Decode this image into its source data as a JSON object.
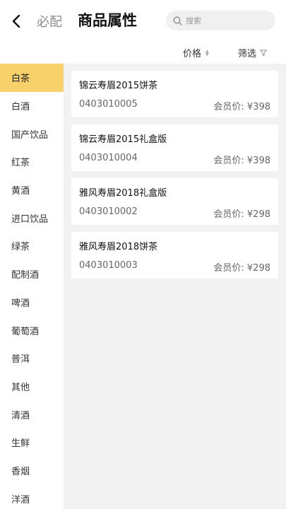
{
  "header": {
    "tab_inactive": "必配",
    "tab_active": "商品属性",
    "search_placeholder": "搜索"
  },
  "sortbar": {
    "price_label": "价格",
    "filter_label": "筛选"
  },
  "categories": [
    {
      "label": "白茶",
      "active": true
    },
    {
      "label": "白酒",
      "active": false
    },
    {
      "label": "国产饮品",
      "active": false
    },
    {
      "label": "红茶",
      "active": false
    },
    {
      "label": "黄酒",
      "active": false
    },
    {
      "label": "进口饮品",
      "active": false
    },
    {
      "label": "绿茶",
      "active": false
    },
    {
      "label": "配制酒",
      "active": false
    },
    {
      "label": "啤酒",
      "active": false
    },
    {
      "label": "葡萄酒",
      "active": false
    },
    {
      "label": "普洱",
      "active": false
    },
    {
      "label": "其他",
      "active": false
    },
    {
      "label": "清酒",
      "active": false
    },
    {
      "label": "生鲜",
      "active": false
    },
    {
      "label": "香烟",
      "active": false
    },
    {
      "label": "洋酒",
      "active": false
    }
  ],
  "products": [
    {
      "name": "锦云寿眉2015饼茶",
      "code": "0403010005",
      "price": "会员价: ¥398"
    },
    {
      "name": "锦云寿眉2015礼盒版",
      "code": "0403010004",
      "price": "会员价: ¥398"
    },
    {
      "name": "雅风寿眉2018礼盒版",
      "code": "0403010002",
      "price": "会员价: ¥298"
    },
    {
      "name": "雅风寿眉2018饼茶",
      "code": "0403010003",
      "price": "会员价: ¥298"
    }
  ],
  "colors": {
    "accent": "#f9d16b",
    "background": "#f2f2f2"
  }
}
